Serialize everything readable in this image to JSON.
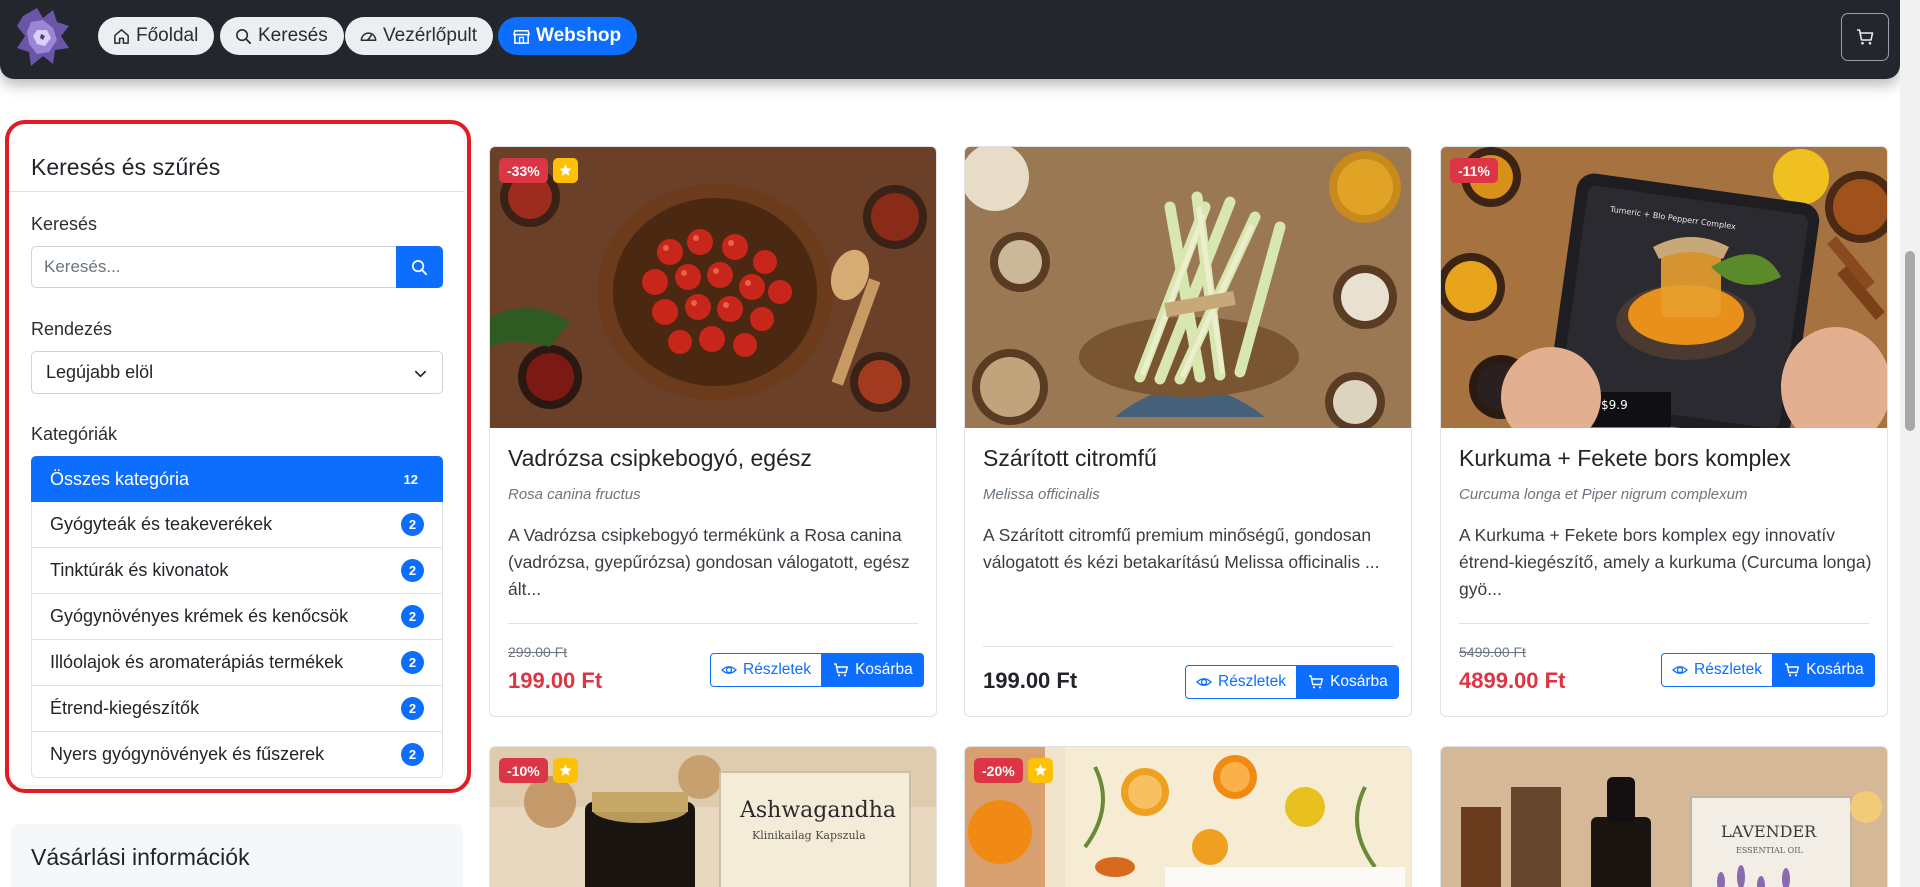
{
  "navbar": {
    "items": [
      {
        "label": "Főoldal",
        "icon": "home-icon"
      },
      {
        "label": "Keresés",
        "icon": "search-icon"
      },
      {
        "label": "Vezérlőpult",
        "icon": "dashboard-icon"
      },
      {
        "label": "Webshop",
        "icon": "store-icon",
        "active": true
      }
    ],
    "cart_icon": "cart-icon"
  },
  "sidebar": {
    "title": "Keresés és szűrés",
    "search_label": "Keresés",
    "search_placeholder": "Keresés...",
    "sort_label": "Rendezés",
    "sort_value": "Legújabb elöl",
    "categories_label": "Kategóriák",
    "categories": [
      {
        "name": "Összes kategória",
        "count": "12",
        "active": true
      },
      {
        "name": "Gyógyteák és teakeverékek",
        "count": "2"
      },
      {
        "name": "Tinktúrák és kivonatok",
        "count": "2"
      },
      {
        "name": "Gyógynövényes krémek és kenőcsök",
        "count": "2"
      },
      {
        "name": "Illóolajok és aromaterápiás termékek",
        "count": "2"
      },
      {
        "name": "Étrend-kiegészítők",
        "count": "2"
      },
      {
        "name": "Nyers gyógynövények és fűszerek",
        "count": "2"
      }
    ]
  },
  "info": {
    "title": "Vásárlási információk"
  },
  "products": [
    {
      "discount": "-33%",
      "featured": true,
      "title": "Vadrózsa csipkebogyó, egész",
      "latin": "Rosa canina fructus",
      "description": "A Vadrózsa csipkebogyó termékünk a Rosa canina (vadrózsa, gyepűrózsa) gondosan válogatott, egész ált...",
      "old_price": "299.00 Ft",
      "price": "199.00 Ft",
      "details_label": "Részletek",
      "cart_label": "Kosárba"
    },
    {
      "discount": "",
      "featured": false,
      "title": "Szárított citromfű",
      "latin": "Melissa officinalis",
      "description": "A Szárított citromfű premium minőségű, gondosan válogatott és kézi betakarítású Melissa officinalis ...",
      "old_price": "",
      "price": "199.00 Ft",
      "details_label": "Részletek",
      "cart_label": "Kosárba"
    },
    {
      "discount": "-11%",
      "featured": false,
      "title": "Kurkuma + Fekete bors komplex",
      "latin": "Curcuma longa et Piper nigrum complexum",
      "description": "A Kurkuma + Fekete bors komplex egy innovatív étrend-kiegészítő, amely a kurkuma (Curcuma longa) gyö...",
      "old_price": "5499.00 Ft",
      "price": "4899.00 Ft",
      "details_label": "Részletek",
      "cart_label": "Kosárba",
      "image_text": {
        "title": "Tumeric + Blo Pepperr Complex",
        "price": "$9.9"
      }
    },
    {
      "discount": "-10%",
      "featured": true,
      "image_text": {
        "box": "Ashwagandha",
        "box_sub": "Klinikailag Kapszula"
      }
    },
    {
      "discount": "-20%",
      "featured": true
    },
    {
      "discount": "",
      "featured": false,
      "image_text": {
        "box": "LAVENDER",
        "box_sub": "ESSENTIAL OIL"
      }
    }
  ],
  "colors": {
    "primary": "#0d6efd",
    "danger": "#dc3545",
    "warning": "#ffc107",
    "navbar": "#23262d",
    "highlight": "#e01b24"
  }
}
